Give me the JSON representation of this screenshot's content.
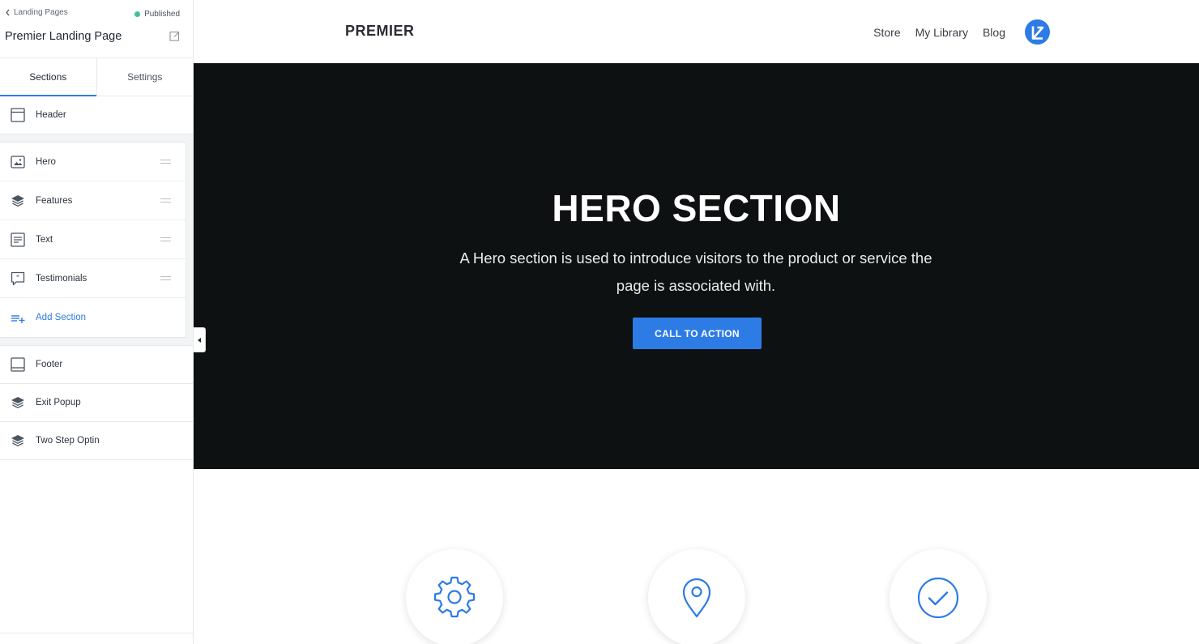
{
  "sidebar": {
    "back_label": "Landing Pages",
    "status": "Published",
    "page_name": "Premier Landing Page",
    "tabs": [
      {
        "label": "Sections"
      },
      {
        "label": "Settings"
      }
    ],
    "fixed_top": {
      "label": "Header",
      "icon": "header-layout-icon"
    },
    "sections": [
      {
        "label": "Hero",
        "icon": "image-icon"
      },
      {
        "label": "Features",
        "icon": "layers-icon"
      },
      {
        "label": "Text",
        "icon": "text-lines-icon"
      },
      {
        "label": "Testimonials",
        "icon": "quote-bubble-icon"
      }
    ],
    "add_section": "Add Section",
    "fixed_bottom": [
      {
        "label": "Footer",
        "icon": "footer-layout-icon"
      },
      {
        "label": "Exit Popup",
        "icon": "layers-icon"
      },
      {
        "label": "Two Step Optin",
        "icon": "layers-icon"
      }
    ]
  },
  "preview": {
    "brand": "PREMIER",
    "nav": [
      "Store",
      "My Library",
      "Blog"
    ],
    "hero": {
      "title": "HERO SECTION",
      "subtitle": "A Hero section is used to introduce visitors to the product or service the page is associated with.",
      "cta": "CALL TO ACTION"
    },
    "features": [
      {
        "icon": "gear-icon"
      },
      {
        "icon": "map-pin-icon"
      },
      {
        "icon": "check-circle-icon"
      }
    ]
  },
  "colors": {
    "accent": "#2d7be5",
    "published": "#3ec28f",
    "hero_bg": "#0e1112"
  }
}
